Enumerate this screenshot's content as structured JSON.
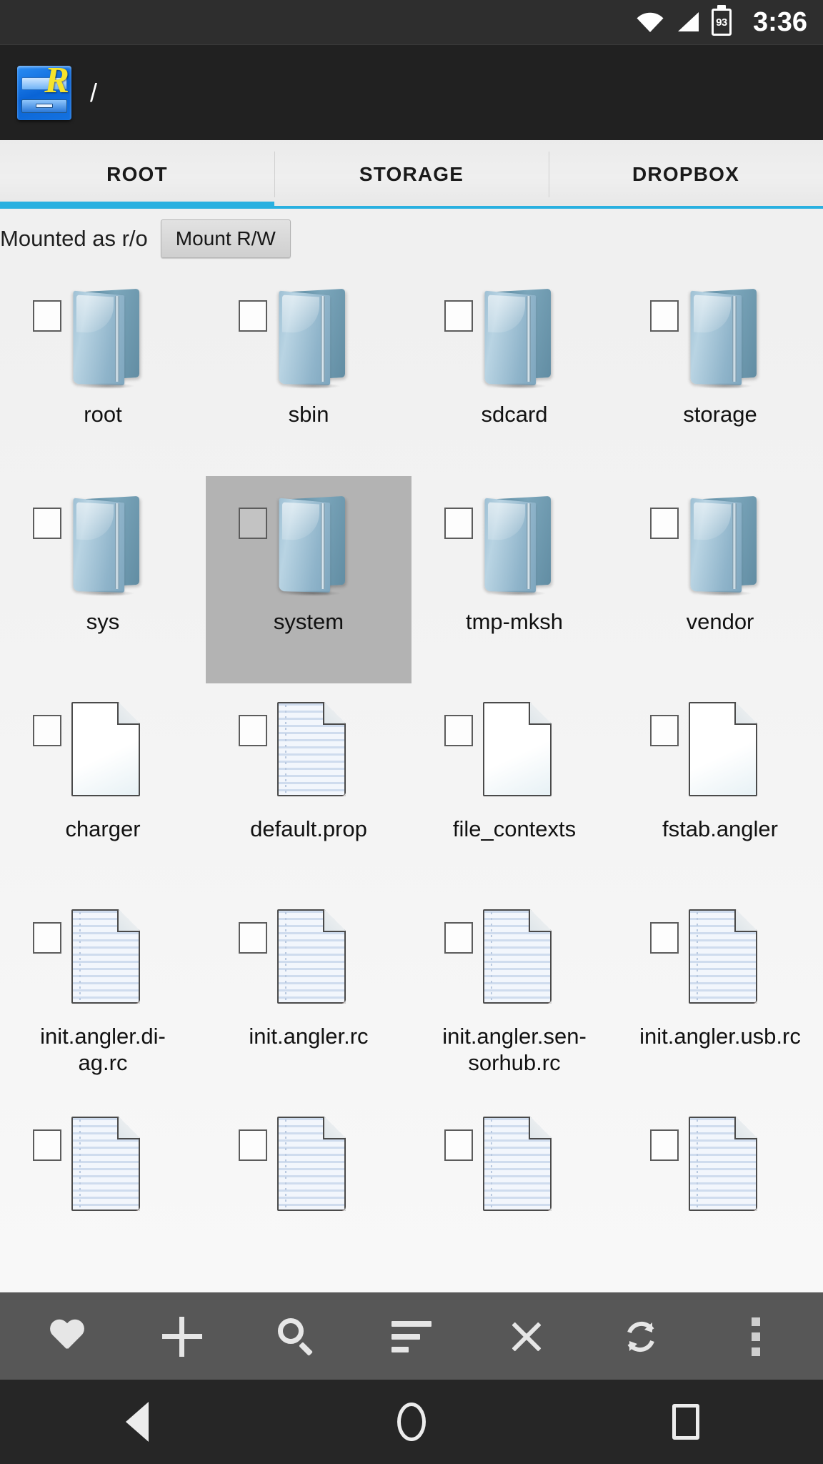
{
  "statusbar": {
    "wifi_icon": "wifi-icon",
    "signal_icon": "cell-signal-icon",
    "battery_icon": "battery-icon",
    "battery_level": "93",
    "clock": "3:36"
  },
  "appbar": {
    "logo_icon": "root-explorer-app-icon",
    "logo_letter": "R",
    "path": "/"
  },
  "tabs": {
    "items": [
      {
        "label": "ROOT",
        "active": true
      },
      {
        "label": "STORAGE",
        "active": false
      },
      {
        "label": "DROPBOX",
        "active": false
      }
    ],
    "accent_color": "#29b0e0"
  },
  "mountbar": {
    "status_text": "Mounted as r/o",
    "button_label": "Mount R/W"
  },
  "filegrid": {
    "columns": 4,
    "selected_item": "system",
    "items": [
      {
        "name": "root",
        "type": "folder",
        "selected": false
      },
      {
        "name": "sbin",
        "type": "folder",
        "selected": false
      },
      {
        "name": "sdcard",
        "type": "folder",
        "selected": false
      },
      {
        "name": "storage",
        "type": "folder",
        "selected": false
      },
      {
        "name": "sys",
        "type": "folder",
        "selected": false
      },
      {
        "name": "system",
        "type": "folder",
        "selected": true
      },
      {
        "name": "tmp-mksh",
        "type": "folder",
        "selected": false
      },
      {
        "name": "vendor",
        "type": "folder",
        "selected": false
      },
      {
        "name": "charger",
        "type": "file-blank",
        "selected": false
      },
      {
        "name": "default.prop",
        "type": "file-text",
        "selected": false
      },
      {
        "name": "file_contexts",
        "type": "file-blank",
        "selected": false
      },
      {
        "name": "fstab.angler",
        "type": "file-blank",
        "selected": false
      },
      {
        "name": "init.angler.di-\nag.rc",
        "type": "file-text",
        "selected": false
      },
      {
        "name": "init.angler.rc",
        "type": "file-text",
        "selected": false
      },
      {
        "name": "init.angler.sen-\nsorhub.rc",
        "type": "file-text",
        "selected": false
      },
      {
        "name": "init.angler.usb.rc",
        "type": "file-text",
        "selected": false
      },
      {
        "name": "",
        "type": "file-text",
        "selected": false
      },
      {
        "name": "",
        "type": "file-text",
        "selected": false
      },
      {
        "name": "",
        "type": "file-text",
        "selected": false
      },
      {
        "name": "",
        "type": "file-text",
        "selected": false
      }
    ]
  },
  "toolbar": {
    "buttons": [
      {
        "icon": "heart-icon",
        "name": "favorites-button"
      },
      {
        "icon": "plus-icon",
        "name": "add-button"
      },
      {
        "icon": "search-icon",
        "name": "search-button"
      },
      {
        "icon": "sort-icon",
        "name": "sort-button"
      },
      {
        "icon": "close-icon",
        "name": "close-button"
      },
      {
        "icon": "refresh-icon",
        "name": "refresh-button"
      },
      {
        "icon": "overflow-menu-icon",
        "name": "overflow-menu-button"
      }
    ]
  },
  "navbar": {
    "back_icon": "back-triangle-icon",
    "home_icon": "home-circle-icon",
    "recents_icon": "recents-square-icon"
  }
}
